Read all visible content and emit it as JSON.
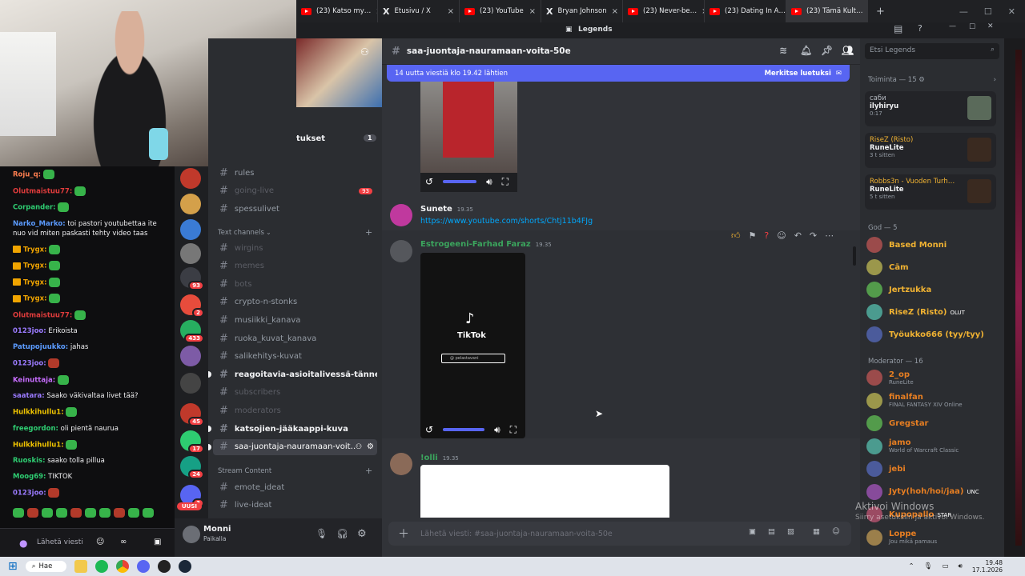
{
  "browser": {
    "tabs": [
      {
        "label": "(23) Katso my…",
        "icon": "youtube-icon"
      },
      {
        "label": "Etusivu / X",
        "icon": "x-logo-icon"
      },
      {
        "label": "(23) YouTube",
        "icon": "youtube-icon"
      },
      {
        "label": "Bryan Johnson",
        "icon": "x-logo-icon"
      },
      {
        "label": "(23) Never-be…",
        "icon": "youtube-icon"
      },
      {
        "label": "(23) Dating In A…",
        "icon": "youtube-icon"
      },
      {
        "label": "(23) Tämä Kult…",
        "icon": "youtube-icon"
      }
    ],
    "new_tab": "+"
  },
  "discord_title": "Legends",
  "stream_chat": {
    "lines": [
      {
        "user": "Roju_q:",
        "color": "#ff7f50",
        "text": ""
      },
      {
        "user": "Olutmaistuu77:",
        "color": "#e03c3c",
        "text": ""
      },
      {
        "user": "Corpander:",
        "color": "#2ecc71",
        "text": ""
      },
      {
        "user": "Narko_Marko:",
        "color": "#5b9bff",
        "text": "toi pastori youtubettaa ite nuo vid miten paskasti tehty video taas"
      },
      {
        "user": "Trygx:",
        "color": "#f0a400",
        "text": ""
      },
      {
        "user": "Trygx:",
        "color": "#f0a400",
        "text": ""
      },
      {
        "user": "Trygx:",
        "color": "#f0a400",
        "text": ""
      },
      {
        "user": "Trygx:",
        "color": "#f0a400",
        "text": ""
      },
      {
        "user": "Olutmaistuu77:",
        "color": "#e03c3c",
        "text": ""
      },
      {
        "user": "0123joo:",
        "color": "#9b7bff",
        "text": "Erikoista"
      },
      {
        "user": "Patupojuukko:",
        "color": "#5b9bff",
        "text": "jahas"
      },
      {
        "user": "0123joo:",
        "color": "#9b7bff",
        "text": ""
      },
      {
        "user": "Keinuttaja:",
        "color": "#c86dff",
        "text": ""
      },
      {
        "user": "saatara:",
        "color": "#9b7bff",
        "text": "Saako väkivaltaa livet tää?"
      },
      {
        "user": "Hulkkihullu1:",
        "color": "#f0c400",
        "text": ""
      },
      {
        "user": "freegordon:",
        "color": "#2ecc71",
        "text": "oli pientä naurua"
      },
      {
        "user": "Hulkkihullu1:",
        "color": "#f0c400",
        "text": ""
      },
      {
        "user": "Ruoskis:",
        "color": "#2ecc71",
        "text": "saako tolla pillua"
      },
      {
        "user": "Moog69:",
        "color": "#2ecc71",
        "text": "TIKTOK"
      },
      {
        "user": "0123joo:",
        "color": "#9b7bff",
        "text": ""
      }
    ],
    "input_placeholder": "Lähetä viesti"
  },
  "channels": {
    "header_partial": "tukset",
    "header_badge": "1",
    "top": [
      {
        "name": "rules",
        "state": "normal"
      },
      {
        "name": "going-live",
        "state": "muted",
        "badge": "93"
      },
      {
        "name": "spessulivet",
        "state": "normal"
      }
    ],
    "text_category": "Text channels",
    "text": [
      {
        "name": "wirgins",
        "state": "muted"
      },
      {
        "name": "memes",
        "state": "muted"
      },
      {
        "name": "bots",
        "state": "muted"
      },
      {
        "name": "crypto-n-stonks",
        "state": "normal"
      },
      {
        "name": "musiikki_kanava",
        "state": "normal"
      },
      {
        "name": "ruoka_kuvat_kanava",
        "state": "normal"
      },
      {
        "name": "salikehitys-kuvat",
        "state": "normal"
      },
      {
        "name": "reagoitavia-asioitalivessä-tänne",
        "state": "unread"
      },
      {
        "name": "subscribers",
        "state": "muted"
      },
      {
        "name": "moderators",
        "state": "muted"
      },
      {
        "name": "katsojien-jääkaappi-kuva",
        "state": "unread"
      },
      {
        "name": "saa-juontaja-nauramaan-voit…",
        "state": "active"
      }
    ],
    "stream_category": "Stream Content",
    "stream": [
      {
        "name": "emote_ideat",
        "state": "normal"
      },
      {
        "name": "live-ideat",
        "state": "normal"
      }
    ]
  },
  "servers": {
    "badges": [
      "93",
      "2",
      "433",
      "45",
      "17",
      "24",
      "3"
    ],
    "new_label": "UUSI"
  },
  "user_panel": {
    "name": "Monni",
    "status": "Paikalla"
  },
  "main": {
    "channel_name": "saa-juontaja-nauramaan-voita-50e",
    "new_messages": "14 uutta viestiä klo 19.42 lähtien",
    "mark_read": "Merkitse luetuksi",
    "messages": [
      {
        "user": "Sunete",
        "color": "#f2f3f5",
        "time": "19.35",
        "link": "https://www.youtube.com/shorts/Chtj11b4FJg"
      },
      {
        "user": "Estrogeeni-Farhad Faraz",
        "color": "#3ba55d",
        "time": "19.35",
        "video_title": "TikTok",
        "video_caption": "@ pelastavani"
      },
      {
        "user": "!olli",
        "color": "#3ba55d",
        "time": "19.35"
      }
    ],
    "message_placeholder": "Lähetä viesti: #saa-juontaja-nauramaan-voita-50e"
  },
  "members": {
    "search_placeholder": "Etsi Legends",
    "activity_header": "Toiminta — 15",
    "activities": [
      {
        "name": "саби",
        "game": "ilyhiryu",
        "detail": "0:17"
      },
      {
        "name": "RiseZ (Risto)",
        "game": "RuneLite",
        "detail": "3 t sitten"
      },
      {
        "name": "Robbs3n - Vuoden Turh…",
        "game": "RuneLite",
        "detail": "5 t sitten"
      }
    ],
    "god_header": "God — 5",
    "gods": [
      {
        "name": "Based Monni",
        "color": "#f0b232"
      },
      {
        "name": "Cām",
        "color": "#f0b232"
      },
      {
        "name": "Jertzukka",
        "color": "#f0b232"
      },
      {
        "name": "RiseZ (Risto)",
        "color": "#f0b232",
        "tag": "OLUT"
      },
      {
        "name": "Työukko666 (tyy/tyy)",
        "color": "#f0b232"
      }
    ],
    "mod_header": "Moderator — 16",
    "mods": [
      {
        "name": "2_op",
        "color": "#e67e22",
        "sub": "RuneLite"
      },
      {
        "name": "finalfan",
        "color": "#e67e22",
        "sub": "FINAL FANTASY XIV Online"
      },
      {
        "name": "Gregstar",
        "color": "#e67e22",
        "sub": ""
      },
      {
        "name": "jamo",
        "color": "#e67e22",
        "sub": "World of Warcraft Classic"
      },
      {
        "name": "jebi",
        "color": "#e67e22",
        "sub": ""
      },
      {
        "name": "Jyty(hoh/hoi/jaa)",
        "color": "#e67e22",
        "sub": "",
        "tag": "UNC"
      },
      {
        "name": "Kupopallo",
        "color": "#e67e22",
        "sub": "",
        "tag": "STAR"
      },
      {
        "name": "Loppe",
        "color": "#e67e22",
        "sub": "Jou mikä pamaus"
      }
    ]
  },
  "watermark": {
    "line1": "Aktivoi Windows",
    "line2": "Siirry asetuksiin ja aktivoi Windows."
  },
  "taskbar": {
    "search": "Hae",
    "time": "19.48",
    "date": "17.1.2026"
  }
}
